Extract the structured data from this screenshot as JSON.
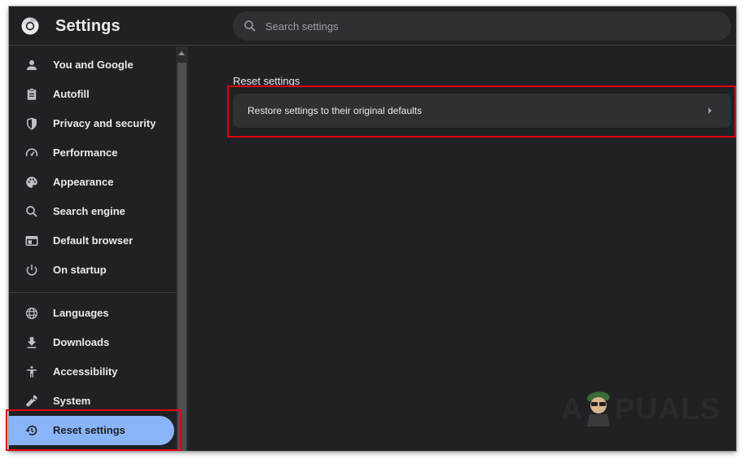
{
  "app": {
    "title": "Settings"
  },
  "search": {
    "placeholder": "Search settings",
    "value": ""
  },
  "sidebar": {
    "items": [
      {
        "label": "You and Google",
        "icon": "person-icon"
      },
      {
        "label": "Autofill",
        "icon": "clipboard-icon"
      },
      {
        "label": "Privacy and security",
        "icon": "shield-icon"
      },
      {
        "label": "Performance",
        "icon": "speedometer-icon"
      },
      {
        "label": "Appearance",
        "icon": "palette-icon"
      },
      {
        "label": "Search engine",
        "icon": "search-icon"
      },
      {
        "label": "Default browser",
        "icon": "browser-window-icon"
      },
      {
        "label": "On startup",
        "icon": "power-icon"
      },
      {
        "label": "Languages",
        "icon": "globe-icon"
      },
      {
        "label": "Downloads",
        "icon": "download-icon"
      },
      {
        "label": "Accessibility",
        "icon": "accessibility-icon"
      },
      {
        "label": "System",
        "icon": "wrench-icon"
      },
      {
        "label": "Reset settings",
        "icon": "restore-history-icon",
        "active": true
      }
    ]
  },
  "main": {
    "section_title": "Reset settings",
    "restore_label": "Restore settings to their original defaults"
  },
  "watermark": {
    "text_left": "A",
    "text_right": "PUALS"
  },
  "colors": {
    "background": "#202124",
    "active": "#8ab4f8",
    "text": "#e8eaed",
    "card": "#2f3033",
    "highlight": "#e0000e"
  }
}
